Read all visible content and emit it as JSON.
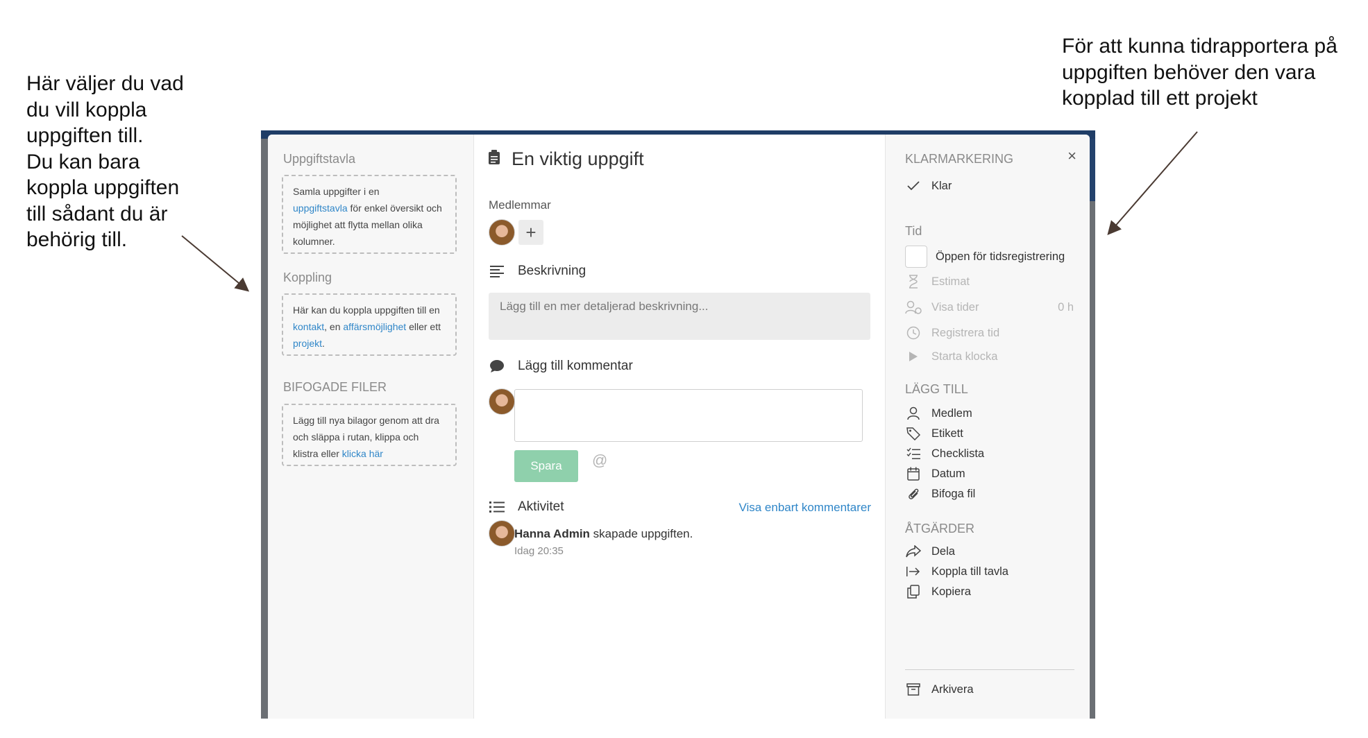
{
  "annotations": {
    "left": [
      "Här väljer du vad",
      "du vill koppla",
      "uppgiften till.",
      "Du kan bara",
      "koppla uppgiften",
      "till sådant du är",
      "behörig till."
    ],
    "right": [
      "För att kunna tidrapportera på",
      "uppgiften behöver den vara",
      "kopplad till ett projekt"
    ]
  },
  "left_panel": {
    "board": {
      "heading": "Uppgiftstavla",
      "text_a": "Samla uppgifter i en",
      "link": "uppgiftstavla",
      "text_b": " för enkel översikt och möjlighet att flytta mellan olika kolumner."
    },
    "connection": {
      "heading": "Koppling",
      "text_a": "Här kan du koppla uppgiften till en ",
      "link_contact": "kontakt",
      "text_b": ", en ",
      "link_deal": "affärsmöjlighet",
      "text_c": " eller ett ",
      "link_project": "projekt",
      "text_d": "."
    },
    "files": {
      "heading": "BIFOGADE FILER",
      "text_a": "Lägg till nya bilagor genom att dra och släppa i rutan, klippa och klistra eller ",
      "link": "klicka här"
    }
  },
  "main": {
    "title": "En viktig uppgift",
    "members_label": "Medlemmar",
    "add_member": "+",
    "description_title": "Beskrivning",
    "description_placeholder": "Lägg till en mer detaljerad beskrivning...",
    "comment_title": "Lägg till kommentar",
    "save_label": "Spara",
    "mention": "@",
    "activity_title": "Aktivitet",
    "show_comments_only": "Visa enbart kommentarer",
    "activity": {
      "user": "Hanna Admin",
      "action": " skapade uppgiften.",
      "time": "Idag 20:35"
    }
  },
  "right_panel": {
    "close": "×",
    "done_heading": "KLARMARKERING",
    "done_label": "Klar",
    "time_heading": "Tid",
    "open_for_time": "Öppen för tidsregistrering",
    "estimate": "Estimat",
    "show_times": "Visa tider",
    "show_times_value": "0 h",
    "register_time": "Registrera tid",
    "start_clock": "Starta klocka",
    "add_heading": "LÄGG TILL",
    "add_items": [
      "Medlem",
      "Etikett",
      "Checklista",
      "Datum",
      "Bifoga fil"
    ],
    "actions_heading": "ÅTGÄRDER",
    "action_items": [
      "Dela",
      "Koppla till tavla",
      "Kopiera"
    ],
    "archive": "Arkivera"
  }
}
